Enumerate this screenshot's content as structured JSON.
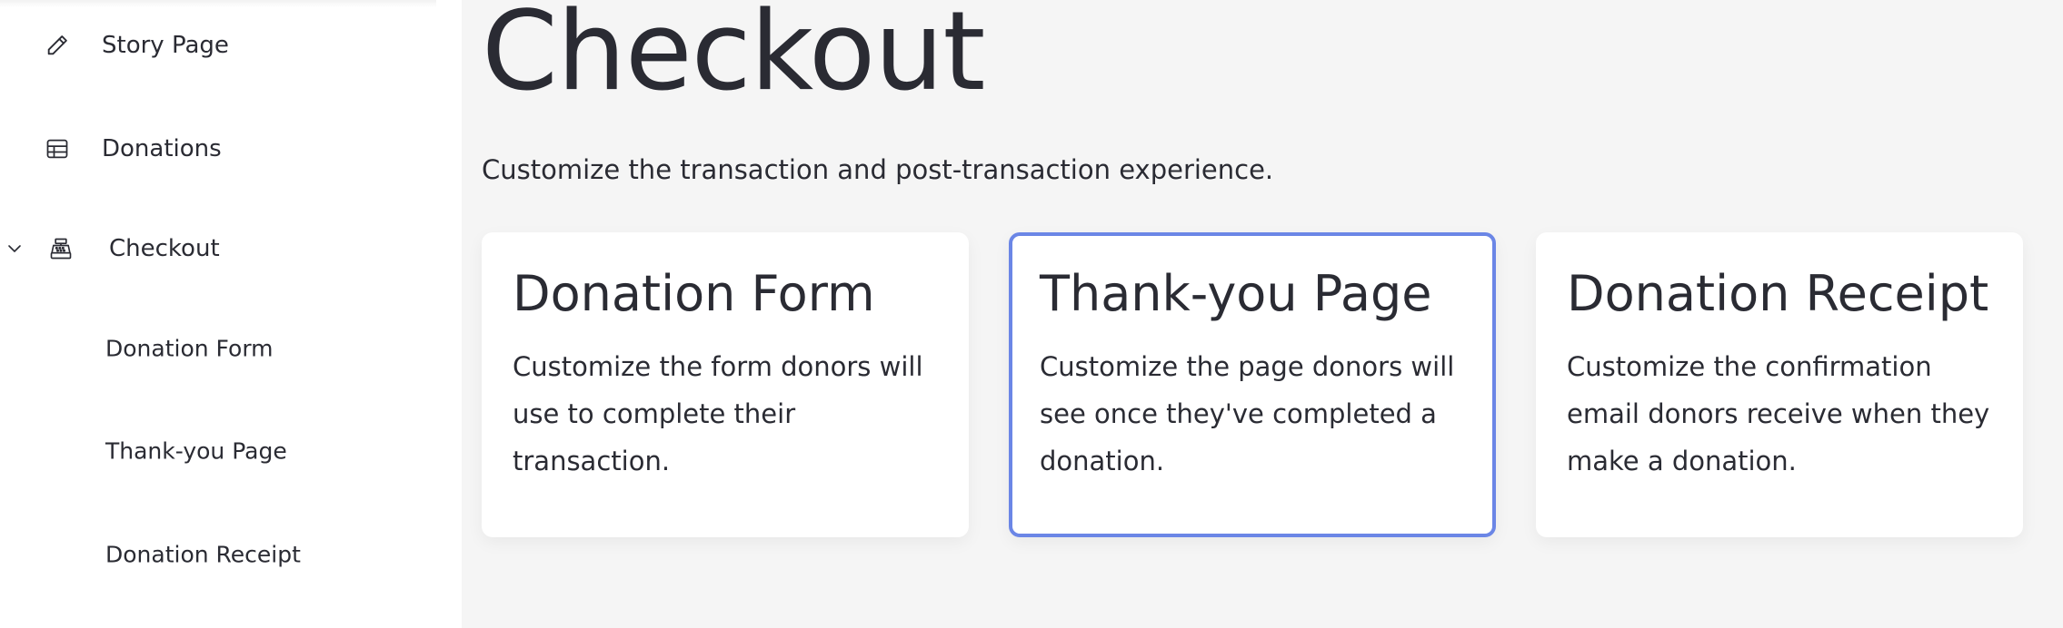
{
  "sidebar": {
    "items": [
      {
        "label": "Story Page",
        "icon": "pencil-icon"
      },
      {
        "label": "Donations",
        "icon": "table-icon"
      },
      {
        "label": "Checkout",
        "icon": "cash-register-icon",
        "expanded": true
      }
    ],
    "sub_items": [
      {
        "label": "Donation Form"
      },
      {
        "label": "Thank-you Page"
      },
      {
        "label": "Donation Receipt"
      }
    ]
  },
  "main": {
    "title": "Checkout",
    "subtitle": "Customize the transaction and post-transaction experience.",
    "cards": [
      {
        "title": "Donation Form",
        "description": "Customize the form donors will use to complete their transaction.",
        "selected": false
      },
      {
        "title": "Thank-you Page",
        "description": "Customize the page donors will see once they've completed a donation.",
        "selected": true
      },
      {
        "title": "Donation Receipt",
        "description": "Customize the confirmation email donors receive when they make a donation.",
        "selected": false
      }
    ]
  },
  "colors": {
    "accent": "#6b86e6",
    "text": "#2a2b33",
    "main_bg": "#f5f5f5",
    "card_bg": "#ffffff"
  }
}
